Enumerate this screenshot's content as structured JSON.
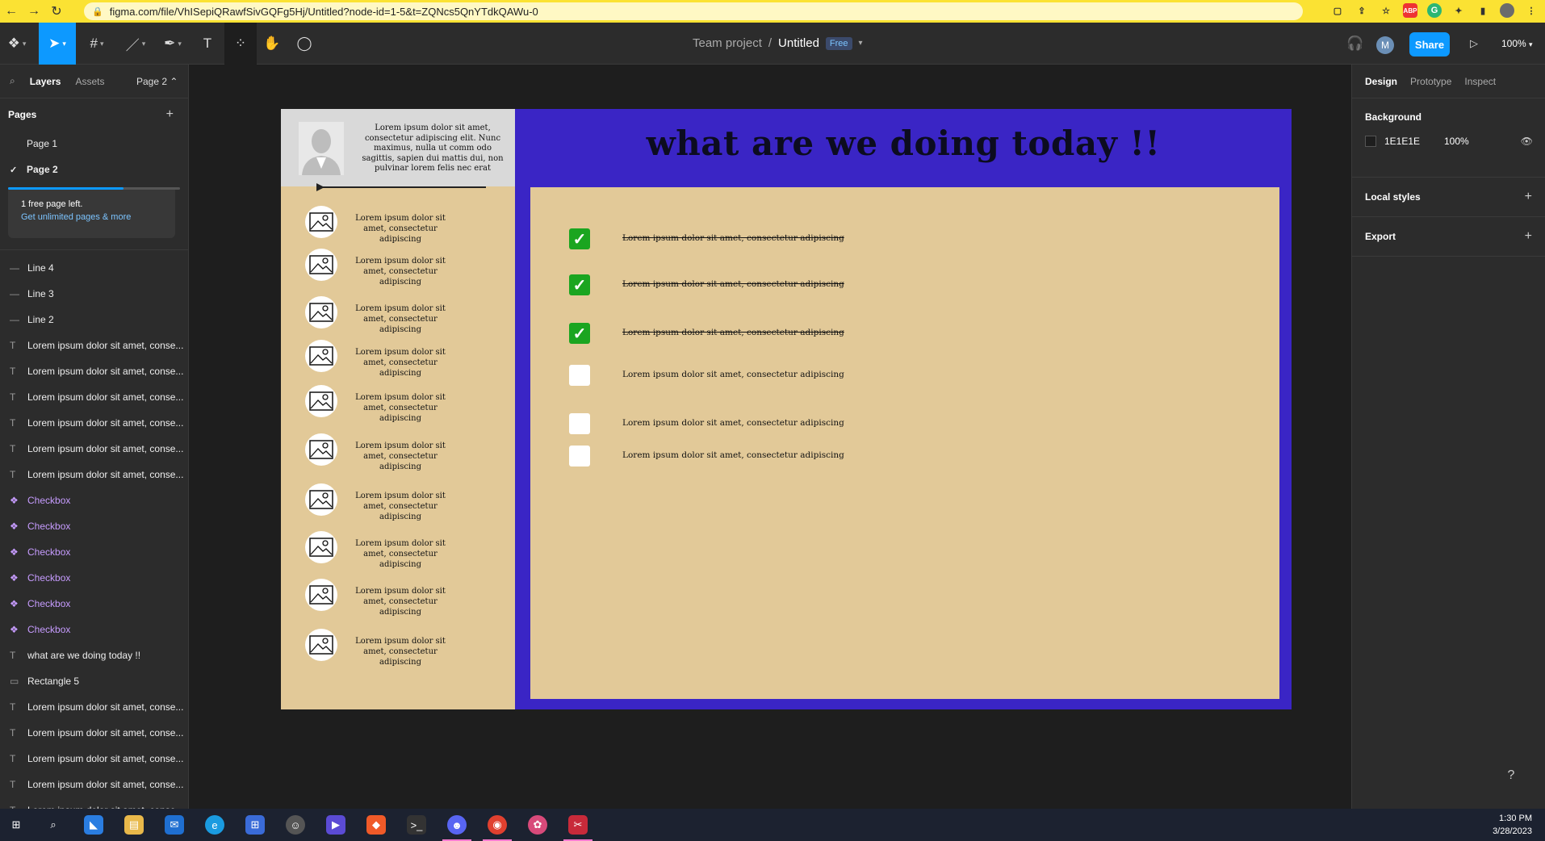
{
  "browser": {
    "url": "figma.com/file/VhISepiQRawfSivGQFg5Hj/Untitled?node-id=1-5&t=ZQNcs5QnYTdkQAWu-0",
    "extensions": [
      "ABP",
      "G"
    ]
  },
  "toolbar": {
    "team": "Team project",
    "separator": "/",
    "file_name": "Untitled",
    "plan_badge": "Free",
    "avatar_initial": "M",
    "share_label": "Share",
    "zoom": "100%"
  },
  "left_panel": {
    "tabs": [
      "Layers",
      "Assets"
    ],
    "page_selector": "Page 2 ⌃",
    "pages_heading": "Pages",
    "pages": [
      {
        "label": "Page 1",
        "selected": false
      },
      {
        "label": "Page 2",
        "selected": true
      }
    ],
    "free_pages_progress": 0.67,
    "upgrade_text": "1 free page left.",
    "upgrade_link": "Get unlimited pages & more",
    "layers": [
      {
        "label": "Line 4",
        "type": "line"
      },
      {
        "label": "Line 3",
        "type": "line"
      },
      {
        "label": "Line 2",
        "type": "line"
      },
      {
        "label": "Lorem ipsum dolor sit amet, conse...",
        "type": "text"
      },
      {
        "label": "Lorem ipsum dolor sit amet, conse...",
        "type": "text"
      },
      {
        "label": "Lorem ipsum dolor sit amet, conse...",
        "type": "text"
      },
      {
        "label": "Lorem ipsum dolor sit amet, conse...",
        "type": "text"
      },
      {
        "label": "Lorem ipsum dolor sit amet, conse...",
        "type": "text"
      },
      {
        "label": "Lorem ipsum dolor sit amet, conse...",
        "type": "text"
      },
      {
        "label": "Checkbox",
        "type": "component"
      },
      {
        "label": "Checkbox",
        "type": "component"
      },
      {
        "label": "Checkbox",
        "type": "component"
      },
      {
        "label": "Checkbox",
        "type": "component"
      },
      {
        "label": "Checkbox",
        "type": "component"
      },
      {
        "label": "Checkbox",
        "type": "component"
      },
      {
        "label": "what are we doing today !!",
        "type": "text"
      },
      {
        "label": "Rectangle 5",
        "type": "rect"
      },
      {
        "label": "Lorem ipsum dolor sit amet, conse...",
        "type": "text"
      },
      {
        "label": "Lorem ipsum dolor sit amet, conse...",
        "type": "text"
      },
      {
        "label": "Lorem ipsum dolor sit amet, conse...",
        "type": "text"
      },
      {
        "label": "Lorem ipsum dolor sit amet, conse...",
        "type": "text"
      },
      {
        "label": "Lorem ipsum dolor sit amet, conse...",
        "type": "text"
      }
    ]
  },
  "right_panel": {
    "tabs": [
      "Design",
      "Prototype",
      "Inspect"
    ],
    "background_label": "Background",
    "background_hex": "1E1E1E",
    "background_opacity": "100%",
    "local_styles": "Local styles",
    "export": "Export",
    "help": "?"
  },
  "design": {
    "title": "what are we doing today !!",
    "profile_text": "Lorem ipsum dolor sit amet, consectetur adipiscing elit. Nunc maximus, nulla ut comm odo sagittis, sapien dui mattis dui, non pulvinar lorem felis nec erat",
    "side_items": [
      "Lorem ipsum dolor sit amet, consectetur adipiscing",
      "Lorem ipsum dolor sit amet, consectetur adipiscing",
      "Lorem ipsum dolor sit amet, consectetur adipiscing",
      "Lorem ipsum dolor sit amet, consectetur adipiscing",
      "Lorem ipsum dolor sit amet, consectetur adipiscing",
      "Lorem ipsum dolor sit amet, consectetur adipiscing",
      "Lorem ipsum dolor sit amet, consectetur adipiscing",
      "Lorem ipsum dolor sit amet, consectetur adipiscing",
      "Lorem ipsum dolor sit amet, consectetur adipiscing",
      "Lorem ipsum dolor sit amet, consectetur adipiscing"
    ],
    "tasks": [
      {
        "text": "Lorem ipsum dolor sit amet, consectetur adipiscing",
        "done": true
      },
      {
        "text": "Lorem ipsum dolor sit amet, consectetur adipiscing",
        "done": true
      },
      {
        "text": "Lorem ipsum dolor sit amet, consectetur adipiscing",
        "done": true
      },
      {
        "text": "Lorem ipsum dolor sit amet, consectetur adipiscing",
        "done": false
      },
      {
        "text": "Lorem ipsum dolor sit amet, consectetur adipiscing",
        "done": false
      },
      {
        "text": "Lorem ipsum dolor sit amet, consectetur adipiscing",
        "done": false
      }
    ],
    "colors": {
      "frame": "#3a25c5",
      "card": "#e2c998",
      "check": "#1ba520"
    }
  },
  "taskbar": {
    "time": "1:30 PM",
    "date": "3/28/2023"
  }
}
